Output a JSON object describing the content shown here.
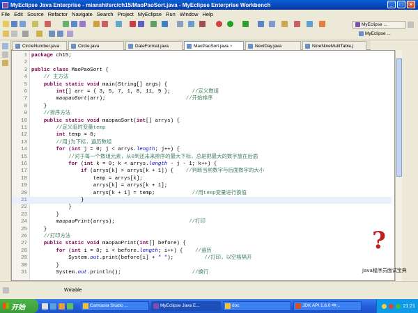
{
  "window": {
    "title": "MyEclipse Java Enterprise - mianshi/src/ch15/MaoPaoSort.java - MyEclipse Enterprise Workbench"
  },
  "menu": [
    "File",
    "Edit",
    "Source",
    "Refactor",
    "Navigate",
    "Search",
    "Project",
    "MyEclipse",
    "Run",
    "Window",
    "Help"
  ],
  "perspectives": [
    {
      "label": "MyEclipse ..."
    },
    {
      "label": "MyEclipse ..."
    }
  ],
  "tabs": [
    {
      "label": "CircleNumber.java",
      "active": false
    },
    {
      "label": "Circle.java",
      "active": false
    },
    {
      "label": "DateFormat.java",
      "active": false
    },
    {
      "label": "MaoPaoSort.java",
      "active": true
    },
    {
      "label": "NextDay.java",
      "active": false
    },
    {
      "label": "NineNineMulitTable.j",
      "active": false
    }
  ],
  "code": [
    {
      "n": "1",
      "html": "<span class='kw'>package</span> ch15;"
    },
    {
      "n": "2",
      "html": ""
    },
    {
      "n": "3",
      "html": "<span class='kw'>public class</span> MaoPaoSort {"
    },
    {
      "n": "4",
      "html": "    <span class='cm'>// 主方法</span>"
    },
    {
      "n": "5",
      "html": "    <span class='kw'>public static void</span> main(String[] args) {"
    },
    {
      "n": "6",
      "html": "        <span class='kw'>int</span>[] arr = { 3, 5, 7, 1, 8, 11, 9 };       <span class='cm'>//定义数组</span>"
    },
    {
      "n": "7",
      "html": "        <span class='it'>maopaoSort</span>(arr);                          <span class='cm'>//开始排序</span>"
    },
    {
      "n": "8",
      "html": "    }"
    },
    {
      "n": "9",
      "html": "    <span class='cm'>//排序方法</span>"
    },
    {
      "n": "10",
      "html": "    <span class='kw'>public static void</span> maopaoSort(<span class='kw'>int</span>[] arrys) {"
    },
    {
      "n": "11",
      "html": "        <span class='cm'>//定义临时变量temp</span>"
    },
    {
      "n": "12",
      "html": "        <span class='kw'>int</span> temp = 0;"
    },
    {
      "n": "13",
      "html": "        <span class='cm'>//用j为下标，遍历数组</span>"
    },
    {
      "n": "14",
      "html": "        <span class='kw'>for</span> (<span class='kw'>int</span> j = 0; j &lt; arrys.<span class='fld'>length</span>; j++) {"
    },
    {
      "n": "15",
      "html": "            <span class='cm'>//对于每一个数组元素，从0到还未来排序的最大下标，总是把最大的数字放在后面</span>"
    },
    {
      "n": "16",
      "html": "            <span class='kw'>for</span> (<span class='kw'>int</span> k = 0; k &lt; arrys.<span class='fld'>length</span> - j - 1; k++) {"
    },
    {
      "n": "17",
      "html": "                <span class='kw'>if</span> (arrys[k] &gt; arrys[k + 1]) {    <span class='cm'>//判断当前数字与后面数字的大小</span>"
    },
    {
      "n": "18",
      "html": "                    temp = arrys[k];"
    },
    {
      "n": "19",
      "html": "                    arrys[k] = arrys[k + 1];"
    },
    {
      "n": "20",
      "html": "                    arrys[k + 1] = temp;            <span class='cm'>//用temp变量进行换值</span>"
    },
    {
      "n": "21",
      "html": "                }",
      "current": true
    },
    {
      "n": "22",
      "html": "            }"
    },
    {
      "n": "23",
      "html": "        }"
    },
    {
      "n": "24",
      "html": "        <span class='it'>maopaoPrint</span>(arrys);                        <span class='cm'>//打印</span>"
    },
    {
      "n": "25",
      "html": "    }"
    },
    {
      "n": "26",
      "html": "    <span class='cm'>//打印方法</span>"
    },
    {
      "n": "27",
      "html": "    <span class='kw'>public static void</span> maopaoPrint(<span class='kw'>int</span>[] before) {"
    },
    {
      "n": "28",
      "html": "        <span class='kw'>for</span> (<span class='kw'>int</span> i = 0; i &lt; before.<span class='fld'>length</span>; i++) {    <span class='cm'>//遍历</span>"
    },
    {
      "n": "29",
      "html": "            System.<span class='fld'>out</span>.print(before[i] + <span class='st'>\" \"</span>);          <span class='cm'>//打印，以空格隔开</span>"
    },
    {
      "n": "30",
      "html": "        }"
    },
    {
      "n": "31",
      "html": "        System.<span class='fld'>out</span>.println();                       <span class='cm'>//换行</span>"
    }
  ],
  "status": {
    "mode": "Writable"
  },
  "watermark": {
    "text": "Java程序员面试宝典"
  },
  "taskbar": {
    "start": "开始",
    "tasks": [
      {
        "label": "Camtasia Studio ...",
        "active": false
      },
      {
        "label": "MyEclipse Java E...",
        "active": true
      },
      {
        "label": "doc",
        "active": false
      },
      {
        "label": "JDK API 1.6.0 中...",
        "active": false
      }
    ],
    "clock": "21:21"
  }
}
